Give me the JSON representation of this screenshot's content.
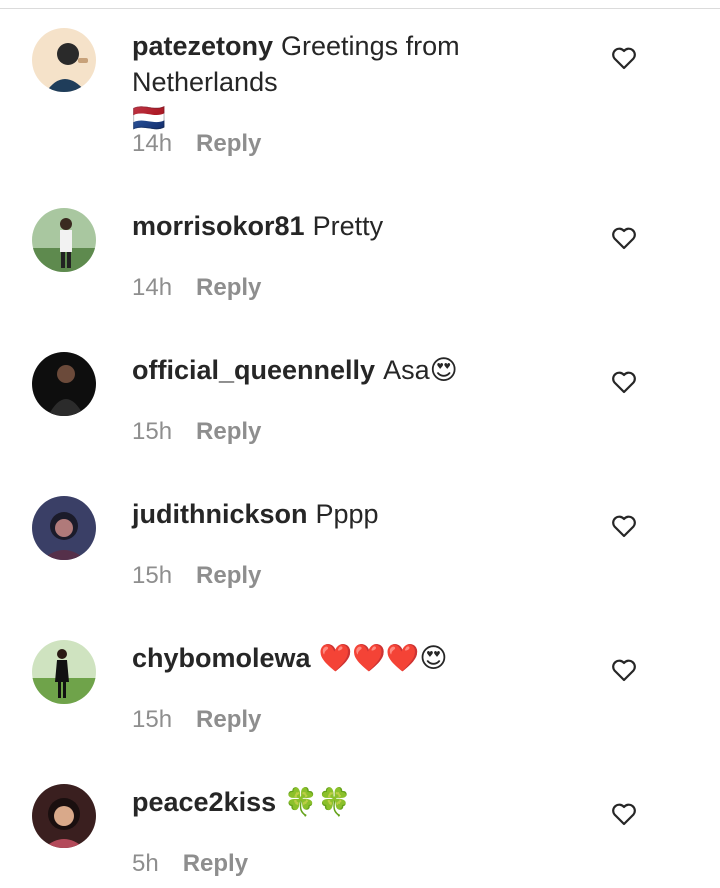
{
  "comments": [
    {
      "username": "patezetony",
      "text": "Greetings from Netherlands",
      "emoji": "🇳🇱",
      "time": "14h",
      "reply": "Reply",
      "avatar_bg": "#f5e2c9"
    },
    {
      "username": "morrisokor81",
      "text": "Pretty",
      "emoji": "",
      "time": "14h",
      "reply": "Reply",
      "avatar_bg": "#7a9a6b"
    },
    {
      "username": "official_queennelly",
      "text": "Asa",
      "emoji": "😍",
      "time": "15h",
      "reply": "Reply",
      "avatar_bg": "#111111"
    },
    {
      "username": "judithnickson",
      "text": "Pppp",
      "emoji": "",
      "time": "15h",
      "reply": "Reply",
      "avatar_bg": "#3a3f66"
    },
    {
      "username": "chybomolewa",
      "text": "",
      "emoji": "❤️❤️❤️😍",
      "time": "15h",
      "reply": "Reply",
      "avatar_bg": "#8fbf6a"
    },
    {
      "username": "peace2kiss",
      "text": "",
      "emoji": "🍀🍀",
      "time": "5h",
      "reply": "Reply",
      "avatar_bg": "#5a2a2a"
    }
  ],
  "colors": {
    "text": "#262626",
    "meta": "#8e8e8e",
    "background": "#ffffff"
  },
  "icons": {
    "like": "heart-outline-icon"
  }
}
